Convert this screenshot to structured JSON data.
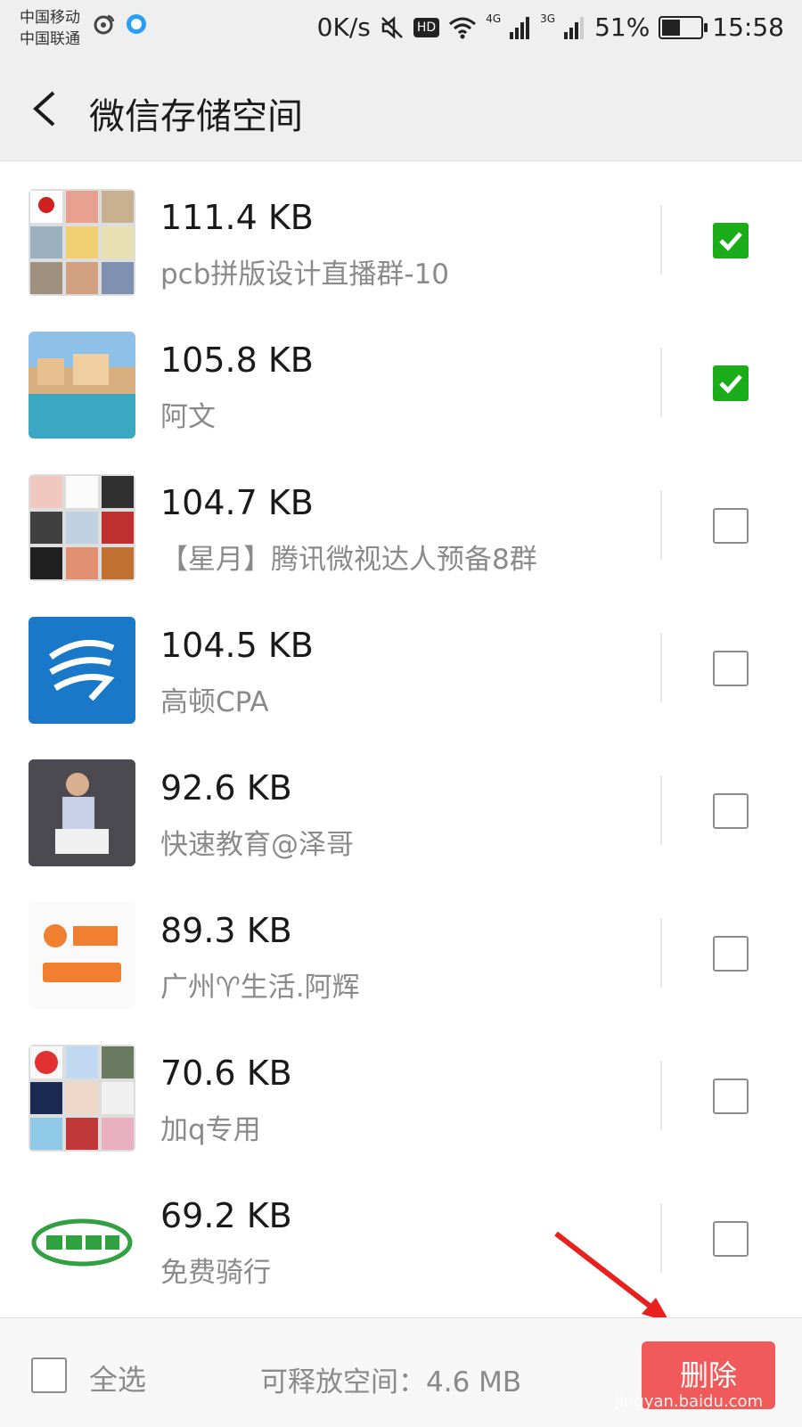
{
  "status_bar": {
    "carrier1": "中国移动",
    "carrier2": "中国联通",
    "speed": "0K/s",
    "hd": "HD",
    "net4g": "4G",
    "net3g": "3G",
    "battery": "51%",
    "battery_level": 0.51,
    "time": "15:58"
  },
  "header": {
    "title": "微信存储空间",
    "back_icon": "chevron-left-icon"
  },
  "items": [
    {
      "size": "111.4 KB",
      "name": "pcb拼版设计直播群-10",
      "checked": true
    },
    {
      "size": "105.8 KB",
      "name": "阿文",
      "checked": true
    },
    {
      "size": "104.7 KB",
      "name": "【星月】腾讯微视达人预备8群",
      "checked": false
    },
    {
      "size": "104.5 KB",
      "name": "高顿CPA",
      "checked": false
    },
    {
      "size": "92.6 KB",
      "name": "快速教育@泽哥",
      "checked": false
    },
    {
      "size": "89.3 KB",
      "name": "广州♈生活.阿辉",
      "checked": false
    },
    {
      "size": "70.6 KB",
      "name": "加q专用",
      "checked": false
    },
    {
      "size": "69.2 KB",
      "name": "免费骑行",
      "checked": false
    }
  ],
  "footer": {
    "select_all": "全选",
    "free_space": "可释放空间：4.6 MB",
    "delete_label": "删除"
  },
  "watermark": "jingyan.baidu.com",
  "colors": {
    "check_green": "#1aad19",
    "delete_red": "#f05a5a",
    "annotation_arrow": "#e8201e"
  }
}
